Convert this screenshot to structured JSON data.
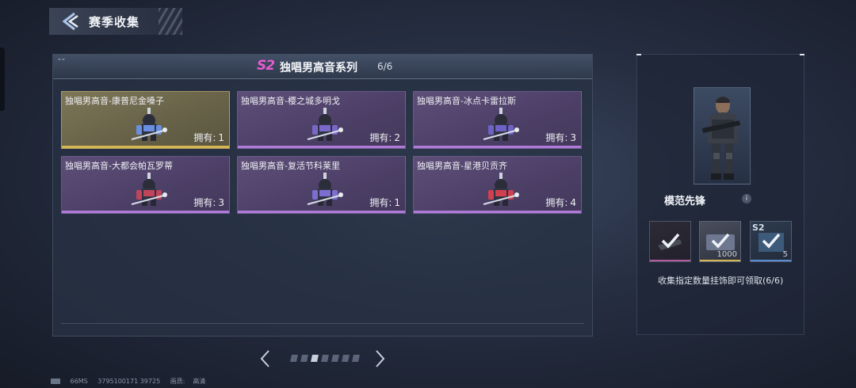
{
  "header": {
    "title": "赛季收集"
  },
  "series": {
    "badge": "S2",
    "title": "独唱男高音系列",
    "progress": "6/6"
  },
  "owned_label": "拥有:",
  "cards": [
    {
      "name": "独唱男高音-康普尼金嗓子",
      "owned": "1",
      "rarity": "gold",
      "accent": "#6a8fe0"
    },
    {
      "name": "独唱男高音-樱之城多明戈",
      "owned": "2",
      "rarity": "purple",
      "accent": "#7a68c8"
    },
    {
      "name": "独唱男高音-冰点卡雷拉斯",
      "owned": "3",
      "rarity": "purple",
      "accent": "#6e62c4"
    },
    {
      "name": "独唱男高音-大都会帕瓦罗蒂",
      "owned": "3",
      "rarity": "purple",
      "accent": "#c0455a"
    },
    {
      "name": "独唱男高音-复活节科莱里",
      "owned": "1",
      "rarity": "purple",
      "accent": "#7c6ed0"
    },
    {
      "name": "独唱男高音-星港贝贡齐",
      "owned": "4",
      "rarity": "purple",
      "accent": "#d0404f"
    }
  ],
  "pagination": {
    "pages": 7,
    "active": 3
  },
  "reward": {
    "name": "模范先锋",
    "info_icon": "i",
    "collect_text": "收集指定数量挂饰即可领取(6/6)",
    "slots": [
      {
        "icon": "gun-item-icon",
        "qty": "",
        "tag": "",
        "bar": "#b05a9a"
      },
      {
        "icon": "ticket-item-icon",
        "qty": "1000",
        "tag": "",
        "bar": "#d6b650"
      },
      {
        "icon": "crate-item-icon",
        "qty": "5",
        "tag": "S2",
        "bar": "#5a8ad0"
      }
    ]
  },
  "footer": {
    "ping": "66MS",
    "uid": "3795100171 39725",
    "quality_label": "画质:",
    "quality": "高清"
  }
}
